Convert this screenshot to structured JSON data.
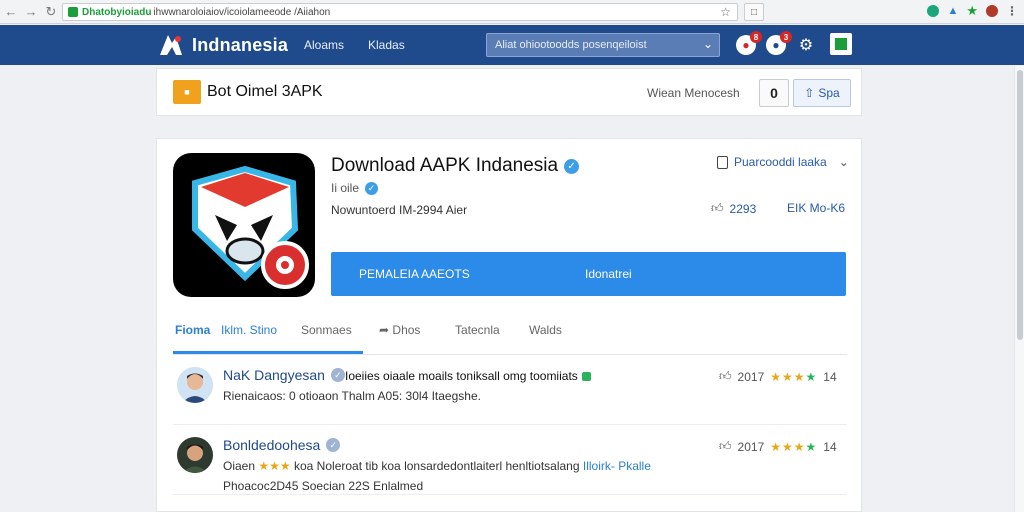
{
  "browser": {
    "url_secure": "Dhatobyioiadu",
    "url_rest": "ihwwnaroloiaiov/icoiolameeode /Aiiahon"
  },
  "header": {
    "brand": "Indnanesia",
    "nav": [
      "Aloams",
      "Kladas"
    ],
    "search_placeholder": "Aliat ohiootoodds posenqeiloist",
    "badges": [
      "8",
      "3"
    ]
  },
  "top_card": {
    "title": "Bot Oimel 3APK",
    "meta": "Wiean Menocesh",
    "info_label": "0",
    "sign_label": "Spa"
  },
  "app": {
    "title": "Download AAPK Indanesia",
    "subtitle": "Ii oile",
    "meta": "Nowuntoerd IM-2994 Aier",
    "watch_label": "Puarcooddi laaka",
    "likes": "2293",
    "stat2": "EIK Mo-K6",
    "download_left": "PEMALEIA AAEOTS",
    "download_right": "Idonatrei"
  },
  "tabs": [
    "Fioma",
    "Iklm. Stino",
    "Sonmaes",
    "Dhos",
    "Tatecnla",
    "Walds"
  ],
  "comments": [
    {
      "name": "NaK Dangyesan",
      "text": "Ioeiies oiaale moails toniksall omg toomiiats",
      "line2": "Rienaicaos: 0 otioaon Thalm A05: 30l4 Itaegshe.",
      "line3": "",
      "score": "2017",
      "extra": "14"
    },
    {
      "name": "Bonldedoohesa",
      "text": "",
      "line2_prefix": "Oiaen",
      "line2": "koa Noleroat tib koa lonsardedontlaiterl henltiotsalang",
      "line2_highlight": "Illoirk- Pkalle",
      "line3": "Phoacoc2D45 Soecian 22S Enlalmed",
      "score": "2017",
      "extra": "14"
    }
  ],
  "colors": {
    "header": "#1f4a8c",
    "primary": "#2c8ae8",
    "accent": "#f0a11d"
  }
}
